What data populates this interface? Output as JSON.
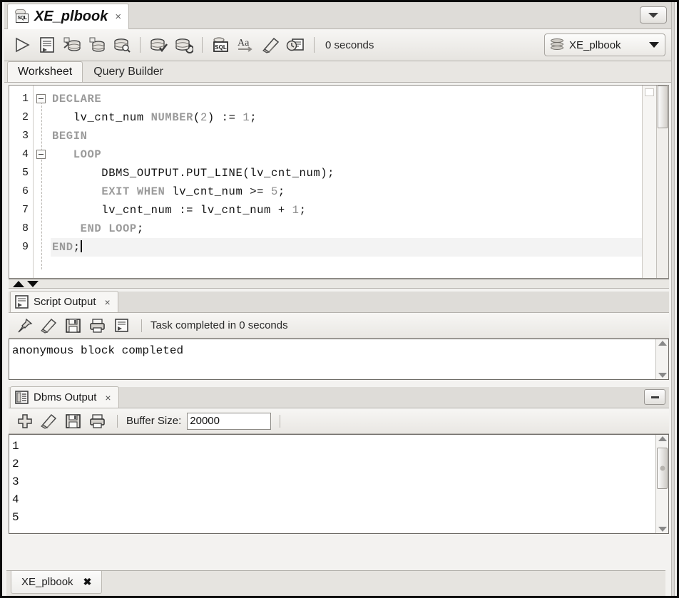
{
  "window": {
    "document_tab": {
      "title": "XE_plbook",
      "icon": "sql-worksheet-icon",
      "close_label": "×"
    },
    "collapse_button_icon": "chevron-down-icon"
  },
  "toolbar": {
    "buttons": [
      {
        "name": "execute-statement-button",
        "icon": "play-icon",
        "label": "Execute Statement"
      },
      {
        "name": "run-script-button",
        "icon": "script-icon",
        "label": "Run Script"
      },
      {
        "name": "commit-button",
        "icon": "commit-icon",
        "label": "Commit"
      },
      {
        "name": "rollback-button",
        "icon": "rollback-icon",
        "label": "Rollback"
      },
      {
        "name": "unshared-sql-worksheet-button",
        "icon": "db-search-icon",
        "label": "Unshared SQL Worksheet"
      },
      {
        "name": "autocommit-button",
        "icon": "db-check-icon",
        "label": "Autocommit"
      },
      {
        "name": "explain-plan-button",
        "icon": "db-plan-icon",
        "label": "Explain Plan"
      },
      {
        "name": "sql-history-button",
        "icon": "sql-tune-icon",
        "label": "SQL Tuning"
      },
      {
        "name": "format-sql-button",
        "icon": "aa-icon",
        "label": "Aa"
      },
      {
        "name": "clear-worksheet-button",
        "icon": "eraser-icon",
        "label": "Clear"
      },
      {
        "name": "query-history-button",
        "icon": "history-icon",
        "label": "Query History"
      }
    ],
    "elapsed_time": "0 seconds",
    "connection": {
      "name": "XE_plbook",
      "icon": "database-icon",
      "dropdown_icon": "caret-down-icon"
    }
  },
  "worksheet_tabs": [
    {
      "label": "Worksheet",
      "active": true
    },
    {
      "label": "Query Builder",
      "active": false
    }
  ],
  "editor": {
    "line_numbers": [
      "1",
      "2",
      "3",
      "4",
      "5",
      "6",
      "7",
      "8",
      "9"
    ],
    "lines": [
      {
        "n": 1,
        "indent": 0,
        "fold": true,
        "segments": [
          {
            "t": "DECLARE",
            "c": "kw"
          }
        ]
      },
      {
        "n": 2,
        "indent": 0,
        "fold": false,
        "segments": [
          {
            "t": "   lv_cnt_num ",
            "c": ""
          },
          {
            "t": "NUMBER",
            "c": "kw"
          },
          {
            "t": "(",
            "c": ""
          },
          {
            "t": "2",
            "c": "num"
          },
          {
            "t": ") := ",
            "c": ""
          },
          {
            "t": "1",
            "c": "num"
          },
          {
            "t": ";",
            "c": ""
          }
        ]
      },
      {
        "n": 3,
        "indent": 0,
        "fold": false,
        "segments": [
          {
            "t": "BEGIN",
            "c": "kw"
          }
        ]
      },
      {
        "n": 4,
        "indent": 0,
        "fold": true,
        "segments": [
          {
            "t": "   ",
            "c": ""
          },
          {
            "t": "LOOP",
            "c": "kw"
          }
        ]
      },
      {
        "n": 5,
        "indent": 0,
        "fold": false,
        "segments": [
          {
            "t": "       DBMS_OUTPUT.PUT_LINE(lv_cnt_num);",
            "c": ""
          }
        ]
      },
      {
        "n": 6,
        "indent": 0,
        "fold": false,
        "segments": [
          {
            "t": "       ",
            "c": ""
          },
          {
            "t": "EXIT WHEN",
            "c": "kw"
          },
          {
            "t": " lv_cnt_num >= ",
            "c": ""
          },
          {
            "t": "5",
            "c": "num"
          },
          {
            "t": ";",
            "c": ""
          }
        ]
      },
      {
        "n": 7,
        "indent": 0,
        "fold": false,
        "segments": [
          {
            "t": "       lv_cnt_num := lv_cnt_num + ",
            "c": ""
          },
          {
            "t": "1",
            "c": "num"
          },
          {
            "t": ";",
            "c": ""
          }
        ]
      },
      {
        "n": 8,
        "indent": 0,
        "fold": false,
        "segments": [
          {
            "t": "    ",
            "c": ""
          },
          {
            "t": "END LOOP",
            "c": "kw"
          },
          {
            "t": ";",
            "c": ""
          }
        ]
      },
      {
        "n": 9,
        "indent": 0,
        "fold": false,
        "caret": true,
        "segments": [
          {
            "t": "END",
            "c": "kw"
          },
          {
            "t": ";",
            "c": ""
          }
        ]
      }
    ]
  },
  "splitter": {
    "up_icon": "triangle-up-icon",
    "down_icon": "triangle-down-icon"
  },
  "script_output": {
    "tab_label": "Script Output",
    "tab_icon": "script-output-icon",
    "tab_close": "×",
    "buttons": [
      {
        "name": "pin-output-button",
        "icon": "pin-icon"
      },
      {
        "name": "clear-output-button",
        "icon": "eraser-icon"
      },
      {
        "name": "save-output-button",
        "icon": "save-icon"
      },
      {
        "name": "print-output-button",
        "icon": "printer-icon"
      },
      {
        "name": "toggle-wrap-button",
        "icon": "script-icon"
      }
    ],
    "status": "Task completed in 0 seconds",
    "content": "anonymous block completed",
    "scroll_up_icon": "chevron-up-icon",
    "scroll_down_icon": "chevron-down-icon"
  },
  "dbms_output": {
    "tab_label": "Dbms Output",
    "tab_icon": "dbms-output-icon",
    "tab_close": "×",
    "minimize_icon": "minimize-icon",
    "buttons": [
      {
        "name": "enable-dbms-output-button",
        "icon": "plus-icon"
      },
      {
        "name": "clear-dbms-output-button",
        "icon": "eraser-icon"
      },
      {
        "name": "save-dbms-output-button",
        "icon": "save-icon"
      },
      {
        "name": "print-dbms-output-button",
        "icon": "printer-icon"
      }
    ],
    "buffer_label": "Buffer Size:",
    "buffer_value": "20000",
    "lines": [
      "1",
      "2",
      "3",
      "4",
      "5"
    ],
    "scroll_up_icon": "chevron-up-icon",
    "scroll_down_icon": "chevron-down-icon"
  },
  "bottom_tab": {
    "label": "XE_plbook",
    "close": "✖"
  },
  "colors": {
    "keyword": "#9a9a9a",
    "identifier": "#111111",
    "number": "#8d8d8d",
    "panel_bg": "#f3f2f0",
    "toolbar_bg": "#eeece8",
    "border": "#8e8b86"
  }
}
